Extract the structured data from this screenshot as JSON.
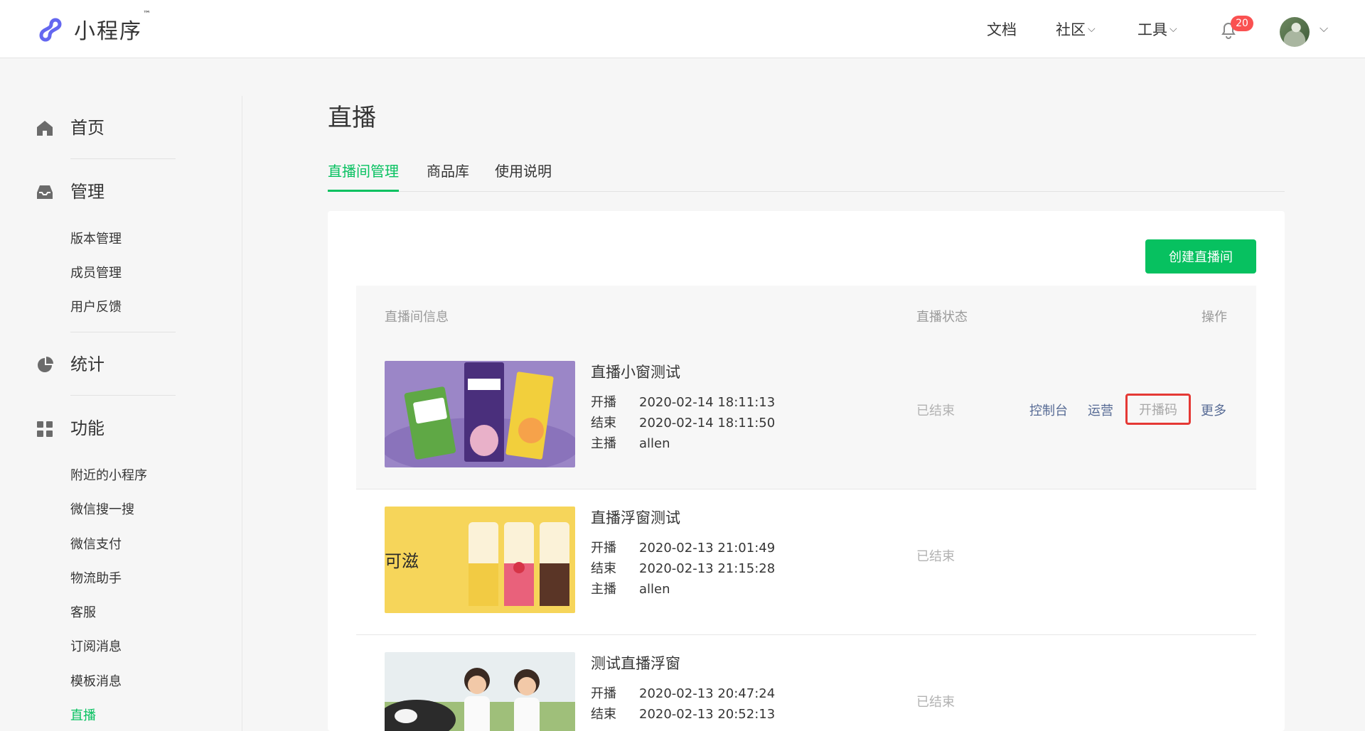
{
  "header": {
    "logo_text": "小程序",
    "logo_tm": "™",
    "nav": {
      "docs": "文档",
      "community": "社区",
      "tools": "工具"
    },
    "notification_count": "20"
  },
  "sidebar": {
    "home": "首页",
    "manage": "管理",
    "manage_items": [
      "版本管理",
      "成员管理",
      "用户反馈"
    ],
    "stats": "统计",
    "features": "功能",
    "feature_items": [
      "附近的小程序",
      "微信搜一搜",
      "微信支付",
      "物流助手",
      "客服",
      "订阅消息",
      "模板消息",
      "直播"
    ]
  },
  "main": {
    "title": "直播",
    "tabs": [
      "直播间管理",
      "商品库",
      "使用说明"
    ],
    "create_button": "创建直播间",
    "table_headers": {
      "info": "直播间信息",
      "status": "直播状态",
      "ops": "操作"
    },
    "rows": [
      {
        "title": "直播小窗测试",
        "start_label": "开播",
        "start": "2020-02-14 18:11:13",
        "end_label": "结束",
        "end": "2020-02-14 18:11:50",
        "host_label": "主播",
        "host": "allen",
        "status": "已结束",
        "ops": [
          "控制台",
          "运营",
          "开播码",
          "更多"
        ]
      },
      {
        "title": "直播浮窗测试",
        "start_label": "开播",
        "start": "2020-02-13 21:01:49",
        "end_label": "结束",
        "end": "2020-02-13 21:15:28",
        "host_label": "主播",
        "host": "allen",
        "thumb_text": "可滋",
        "status": "已结束"
      },
      {
        "title": "测试直播浮窗",
        "start_label": "开播",
        "start": "2020-02-13 20:47:24",
        "end_label": "结束",
        "end": "2020-02-13 20:52:13",
        "status": "已结束"
      }
    ]
  },
  "colors": {
    "accent": "#07c160",
    "link": "#576b95",
    "badge": "#fa5151",
    "highlight_box": "#e53935"
  }
}
